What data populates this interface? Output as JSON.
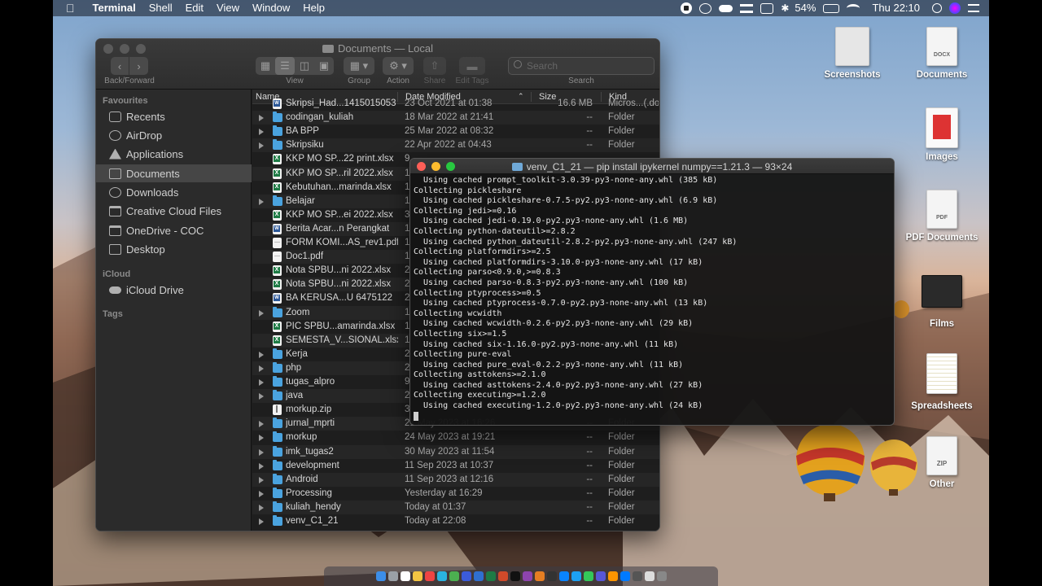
{
  "menubar": {
    "apple": "",
    "app_name": "Terminal",
    "menus": [
      "Shell",
      "Edit",
      "View",
      "Window",
      "Help"
    ],
    "battery": "54%",
    "clock": "Thu 22:10"
  },
  "finder": {
    "title": "Documents — Local",
    "toolbar": {
      "back_forward": "Back/Forward",
      "view": "View",
      "group": "Group",
      "action": "Action",
      "share": "Share",
      "edit_tags": "Edit Tags",
      "search_placeholder": "Search",
      "search_label": "Search"
    },
    "sidebar": {
      "favourites_header": "Favourites",
      "favourites": [
        "Recents",
        "AirDrop",
        "Applications",
        "Documents",
        "Downloads",
        "Creative Cloud Files",
        "OneDrive - COC",
        "Desktop"
      ],
      "icloud_header": "iCloud",
      "icloud": [
        "iCloud Drive"
      ],
      "tags_header": "Tags"
    },
    "columns": {
      "name": "Name",
      "date": "Date Modified",
      "size": "Size",
      "kind": "Kind"
    },
    "rows": [
      {
        "name": "Skripsi_Had...1415015053",
        "date": "23 Oct 2021 at 01:38",
        "size": "16.6 MB",
        "kind": "Micros...(.doc",
        "icon": "docx",
        "folder": false
      },
      {
        "name": "codingan_kuliah",
        "date": "18 Mar 2022 at 21:41",
        "size": "--",
        "kind": "Folder",
        "icon": "folder",
        "folder": true
      },
      {
        "name": "BA BPP",
        "date": "25 Mar 2022 at 08:32",
        "size": "--",
        "kind": "Folder",
        "icon": "folder",
        "folder": true
      },
      {
        "name": "Skripsiku",
        "date": "22 Apr 2022 at 04:43",
        "size": "--",
        "kind": "Folder",
        "icon": "folder",
        "folder": true
      },
      {
        "name": "KKP MO SP...22 print.xlsx",
        "date": "9",
        "size": "",
        "kind": "",
        "icon": "xlsx",
        "folder": false
      },
      {
        "name": "KKP MO SP...ril 2022.xlsx",
        "date": "1",
        "size": "",
        "kind": "",
        "icon": "xlsx",
        "folder": false
      },
      {
        "name": "Kebutuhan...marinda.xlsx",
        "date": "1",
        "size": "",
        "kind": "",
        "icon": "xlsx",
        "folder": false
      },
      {
        "name": "Belajar",
        "date": "1",
        "size": "",
        "kind": "",
        "icon": "folder",
        "folder": true
      },
      {
        "name": "KKP MO SP...ei 2022.xlsx",
        "date": "3",
        "size": "",
        "kind": "",
        "icon": "xlsx",
        "folder": false
      },
      {
        "name": "Berita Acar...n Perangkat",
        "date": "1",
        "size": "",
        "kind": "",
        "icon": "docx",
        "folder": false
      },
      {
        "name": "FORM KOMI...AS_rev1.pdf",
        "date": "1",
        "size": "",
        "kind": "",
        "icon": "pdf",
        "folder": false
      },
      {
        "name": "Doc1.pdf",
        "date": "1",
        "size": "",
        "kind": "",
        "icon": "pdf",
        "folder": false
      },
      {
        "name": "Nota SPBU...ni 2022.xlsx",
        "date": "2",
        "size": "",
        "kind": "",
        "icon": "xlsx",
        "folder": false
      },
      {
        "name": "Nota SPBU...ni 2022.xlsx",
        "date": "2",
        "size": "",
        "kind": "",
        "icon": "xlsx",
        "folder": false
      },
      {
        "name": "BA KERUSA...U 6475122",
        "date": "2",
        "size": "",
        "kind": "",
        "icon": "docx",
        "folder": false
      },
      {
        "name": "Zoom",
        "date": "1",
        "size": "",
        "kind": "",
        "icon": "folder",
        "folder": true
      },
      {
        "name": "PIC SPBU...amarinda.xlsx",
        "date": "1",
        "size": "",
        "kind": "",
        "icon": "xlsx",
        "folder": false
      },
      {
        "name": "SEMESTA_V...SIONAL.xlsx",
        "date": "1",
        "size": "",
        "kind": "",
        "icon": "xlsx",
        "folder": false
      },
      {
        "name": "Kerja",
        "date": "2",
        "size": "",
        "kind": "",
        "icon": "folder",
        "folder": true
      },
      {
        "name": "php",
        "date": "2",
        "size": "",
        "kind": "",
        "icon": "folder",
        "folder": true
      },
      {
        "name": "tugas_alpro",
        "date": "9",
        "size": "",
        "kind": "",
        "icon": "folder",
        "folder": true
      },
      {
        "name": "java",
        "date": "2",
        "size": "",
        "kind": "",
        "icon": "folder",
        "folder": true
      },
      {
        "name": "morkup.zip",
        "date": "3",
        "size": "",
        "kind": "",
        "icon": "zip",
        "folder": false
      },
      {
        "name": "jurnal_mprti",
        "date": "21 May 2023 at 16:26",
        "size": "--",
        "kind": "Folder",
        "icon": "folder",
        "folder": true
      },
      {
        "name": "morkup",
        "date": "24 May 2023 at 19:21",
        "size": "--",
        "kind": "Folder",
        "icon": "folder",
        "folder": true
      },
      {
        "name": "imk_tugas2",
        "date": "30 May 2023 at 11:54",
        "size": "--",
        "kind": "Folder",
        "icon": "folder",
        "folder": true
      },
      {
        "name": "development",
        "date": "11 Sep 2023 at 10:37",
        "size": "--",
        "kind": "Folder",
        "icon": "folder",
        "folder": true
      },
      {
        "name": "Android",
        "date": "11 Sep 2023 at 12:16",
        "size": "--",
        "kind": "Folder",
        "icon": "folder",
        "folder": true
      },
      {
        "name": "Processing",
        "date": "Yesterday at 16:29",
        "size": "--",
        "kind": "Folder",
        "icon": "folder",
        "folder": true
      },
      {
        "name": "kuliah_hendy",
        "date": "Today at 01:37",
        "size": "--",
        "kind": "Folder",
        "icon": "folder",
        "folder": true
      },
      {
        "name": "venv_C1_21",
        "date": "Today at 22:08",
        "size": "--",
        "kind": "Folder",
        "icon": "folder",
        "folder": true
      }
    ]
  },
  "terminal": {
    "title": "venv_C1_21 — pip install ipykernel numpy==1.21.3 — 93×24",
    "lines": [
      "  Using cached prompt_toolkit-3.0.39-py3-none-any.whl (385 kB)",
      "Collecting pickleshare",
      "  Using cached pickleshare-0.7.5-py2.py3-none-any.whl (6.9 kB)",
      "Collecting jedi>=0.16",
      "  Using cached jedi-0.19.0-py2.py3-none-any.whl (1.6 MB)",
      "Collecting python-dateutil>=2.8.2",
      "  Using cached python_dateutil-2.8.2-py2.py3-none-any.whl (247 kB)",
      "Collecting platformdirs>=2.5",
      "  Using cached platformdirs-3.10.0-py3-none-any.whl (17 kB)",
      "Collecting parso<0.9.0,>=0.8.3",
      "  Using cached parso-0.8.3-py2.py3-none-any.whl (100 kB)",
      "Collecting ptyprocess>=0.5",
      "  Using cached ptyprocess-0.7.0-py2.py3-none-any.whl (13 kB)",
      "Collecting wcwidth",
      "  Using cached wcwidth-0.2.6-py2.py3-none-any.whl (29 kB)",
      "Collecting six>=1.5",
      "  Using cached six-1.16.0-py2.py3-none-any.whl (11 kB)",
      "Collecting pure-eval",
      "  Using cached pure_eval-0.2.2-py3-none-any.whl (11 kB)",
      "Collecting asttokens>=2.1.0",
      "  Using cached asttokens-2.4.0-py2.py3-none-any.whl (27 kB)",
      "Collecting executing>=1.2.0",
      "  Using cached executing-1.2.0-py2.py3-none-any.whl (24 kB)"
    ]
  },
  "desktop": {
    "icons": [
      {
        "label": "Screenshots",
        "tag": ""
      },
      {
        "label": "Documents",
        "tag": "DOCX"
      },
      {
        "label": "Images",
        "tag": ""
      },
      {
        "label": "PDF Documents",
        "tag": "PDF"
      },
      {
        "label": "Films",
        "tag": ""
      },
      {
        "label": "Spreadsheets",
        "tag": ""
      },
      {
        "label": "Other",
        "tag": "ZIP"
      }
    ]
  },
  "colors": {
    "folder_blue": "#4aa3df",
    "excel_green": "#1e7b45",
    "word_blue": "#2b5797",
    "close_red": "#ff5f57",
    "minimize_yellow": "#febc2e",
    "zoom_green": "#28c840"
  }
}
